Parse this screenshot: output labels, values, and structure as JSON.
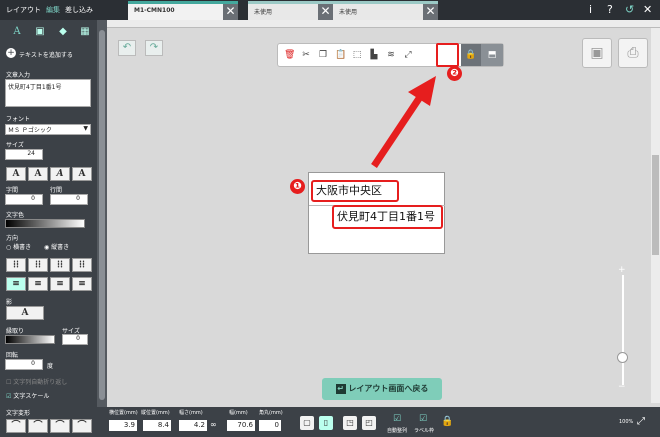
{
  "menu": {
    "items": [
      "レイアウト",
      "編集",
      "差し込み"
    ],
    "active": 1
  },
  "tabs": [
    {
      "label": "M1-CMN100",
      "active": true
    },
    {
      "label": "未使用",
      "active": false
    },
    {
      "label": "未使用",
      "active": false
    }
  ],
  "top_icons": [
    "info-icon",
    "help-icon",
    "undo-icon",
    "close-icon"
  ],
  "left": {
    "add_text": "テキストを追加する",
    "text_input_label": "文章入力",
    "text_input_value": "伏見町4丁目1番1号",
    "font_label": "フォント",
    "font_value": "ＭＳ Ｐゴシック",
    "size_label": "サイズ",
    "size_value": "24",
    "char_spacing_label": "字間",
    "char_spacing_value": "0",
    "line_spacing_label": "行間",
    "line_spacing_value": "0",
    "text_color_label": "文字色",
    "direction_label": "方向",
    "horizontal": "横書き",
    "vertical": "縦書き",
    "shadow_label": "影",
    "border_label": "縁取り",
    "border_size_label": "サイズ",
    "border_size_value": "0",
    "rotate_label": "回転",
    "rotate_value": "0",
    "rotate_unit": "度",
    "fit_label": "文字列自動折り返し",
    "scale_label": "文字スケール",
    "deform_label": "文字変形"
  },
  "canvas": {
    "line1": "大阪市中央区",
    "line2": "伏見町4丁目1番1号",
    "marker1": "❶",
    "marker2": "❷",
    "back_button": "レイアウト画面へ戻る"
  },
  "bottom": {
    "labels": [
      "横位置(mm)",
      "縦位置(mm)",
      "幅さ(mm)",
      "幅(mm)",
      "角丸(mm)"
    ],
    "values": [
      "3.9",
      "8.4",
      "4.2",
      "70.6",
      "0"
    ],
    "link_symbol": "∞",
    "check1": "自動整列",
    "check2": "ラベル枠",
    "zoom": "100%"
  }
}
